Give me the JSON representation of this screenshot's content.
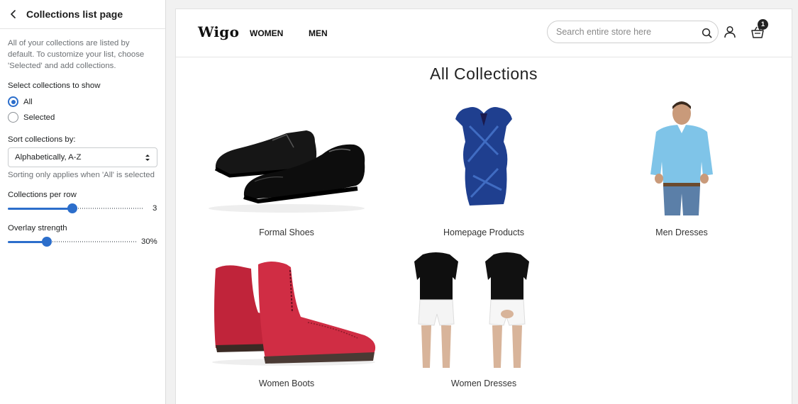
{
  "panel": {
    "title": "Collections list page",
    "description": "All of your collections are listed by default. To customize your list, choose 'Selected' and add collections.",
    "select_label": "Select collections to show",
    "radios": [
      {
        "label": "All",
        "checked": true
      },
      {
        "label": "Selected",
        "checked": false
      }
    ],
    "sort_label": "Sort collections by:",
    "sort_value": "Alphabetically, A-Z",
    "sort_hint": "Sorting only applies when 'All' is selected",
    "per_row": {
      "label": "Collections per row",
      "value": "3",
      "fraction": 0.48
    },
    "overlay": {
      "label": "Overlay strength",
      "value": "30%",
      "fraction": 0.3
    }
  },
  "store": {
    "logo": "Wigo",
    "nav": [
      "WOMEN",
      "MEN"
    ],
    "search_placeholder": "Search entire store here",
    "cart_count": "1",
    "heading": "All Collections",
    "collections": [
      {
        "name": "Formal Shoes",
        "image": "black-oxford-shoes"
      },
      {
        "name": "Homepage Products",
        "image": "blue-sequin-dress"
      },
      {
        "name": "Men Dresses",
        "image": "man-blue-shirt"
      },
      {
        "name": "Women Boots",
        "image": "red-leather-boots"
      },
      {
        "name": "Women Dresses",
        "image": "black-tshirt-white-shorts"
      }
    ]
  },
  "colors": {
    "accent": "#2c6ecb",
    "text": "#202223",
    "muted": "#6d7175"
  }
}
